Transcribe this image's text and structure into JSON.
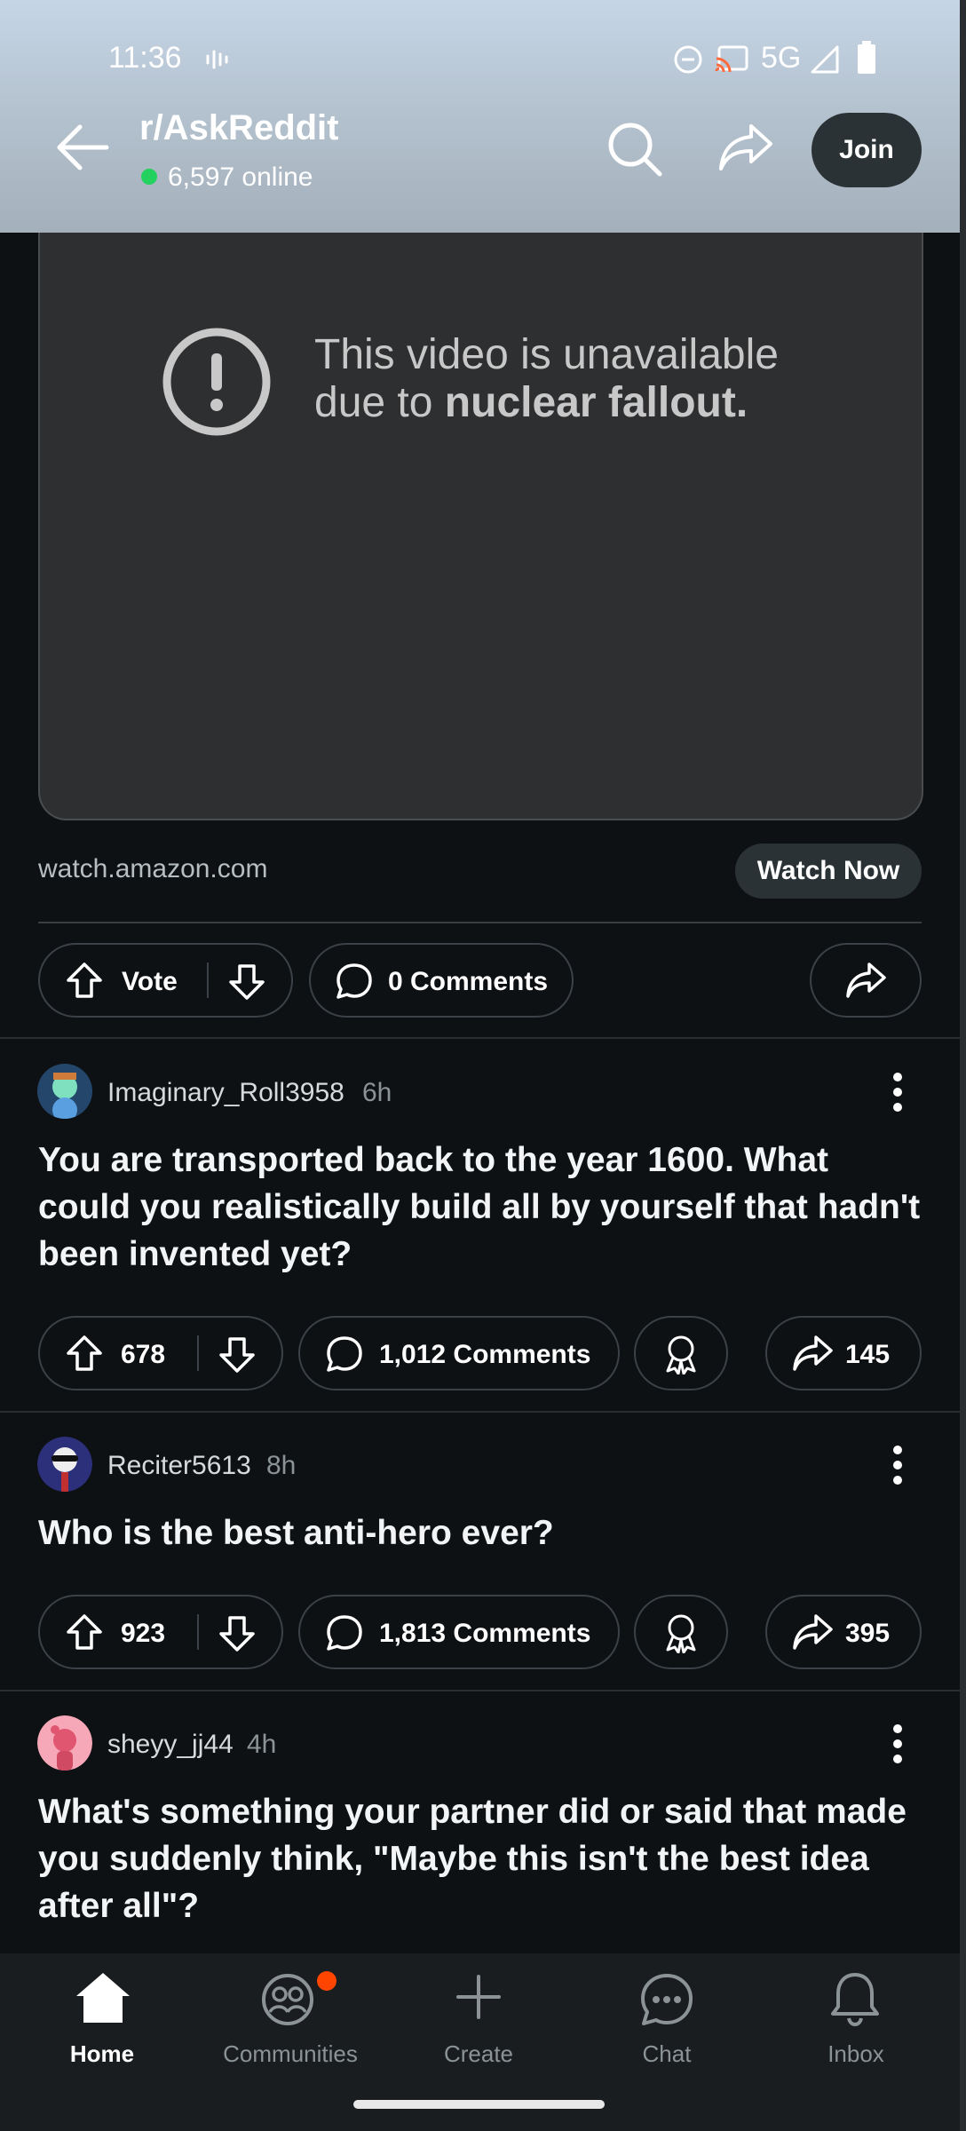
{
  "status_bar": {
    "time": "11:36",
    "network": "5G"
  },
  "header": {
    "subreddit": "r/AskReddit",
    "online": "6,597 online",
    "join_label": "Join"
  },
  "video": {
    "line1": "This video is unavailable",
    "line2_prefix": "due to ",
    "line2_bold": "nuclear fallout.",
    "domain": "watch.amazon.com",
    "watch_label": "Watch Now"
  },
  "post_actions": {
    "vote_label": "Vote",
    "comments_label": "0 Comments"
  },
  "posts": [
    {
      "username": "Imaginary_Roll3958",
      "age": "6h",
      "title": "You are transported back to the year 1600. What could you realistically build all by yourself that hadn't been invented yet?",
      "score": "678",
      "comments": "1,012 Comments",
      "shares": "145"
    },
    {
      "username": "Reciter5613",
      "age": "8h",
      "title": "Who is the best anti-hero ever?",
      "score": "923",
      "comments": "1,813 Comments",
      "shares": "395"
    },
    {
      "username": "sheyy_jj44",
      "age": "4h",
      "title": "What's something your partner did or said that made you suddenly think, \"Maybe this isn't the best idea after all\"?"
    }
  ],
  "nav": [
    {
      "label": "Home",
      "active": true
    },
    {
      "label": "Communities"
    },
    {
      "label": "Create"
    },
    {
      "label": "Chat"
    },
    {
      "label": "Inbox"
    }
  ],
  "colors": {
    "background": "#0e1113",
    "online_dot": "#23d15e",
    "notification_dot": "#ff4500"
  }
}
